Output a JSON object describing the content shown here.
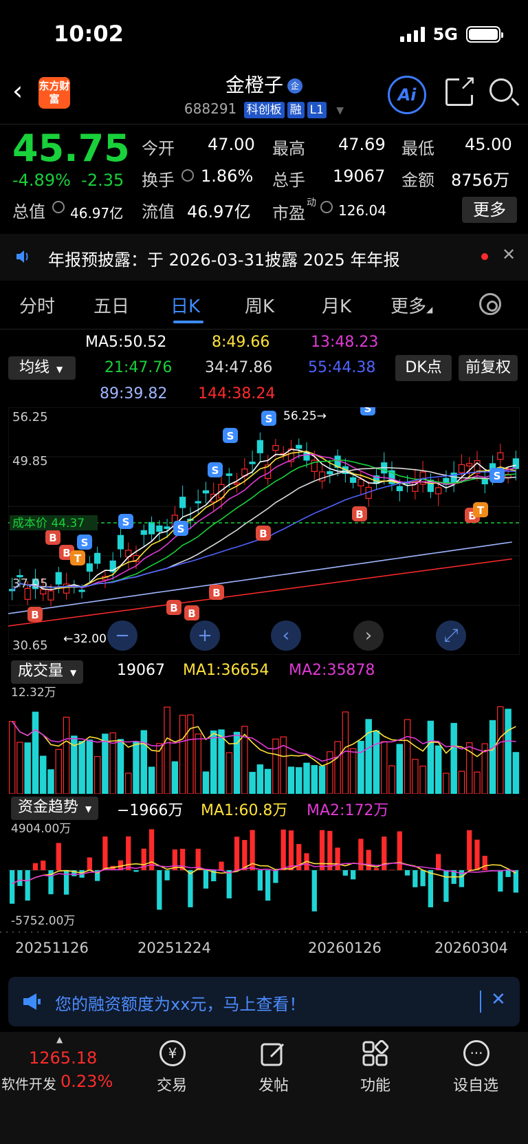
{
  "status": {
    "time": "10:02",
    "network": "5G"
  },
  "header": {
    "title": "金橙子",
    "title_badge": "企",
    "logo_text": "东方财富",
    "code": "688291",
    "tags": [
      "科创板",
      "融",
      "L1"
    ]
  },
  "quote": {
    "price": "45.75",
    "change_pct": "-4.89%",
    "change": "-2.35",
    "open_label": "今开",
    "open": "47.00",
    "high_label": "最高",
    "high": "47.69",
    "low_label": "最低",
    "low": "45.00",
    "turnover_label": "换手",
    "turnover": "1.86%",
    "volume_label": "总手",
    "volume": "19067",
    "amount_label": "金额",
    "amount": "8756万",
    "mcap_label": "总值",
    "mcap": "46.97亿",
    "float_label": "流值",
    "float_cap": "46.97亿",
    "pe_label": "市盈",
    "pe_sup": "动",
    "pe": "126.04",
    "more": "更多"
  },
  "notice": {
    "text": "年报预披露：于 2026-03-31披露 2025 年年报"
  },
  "tabs": [
    "分时",
    "五日",
    "日K",
    "周K",
    "月K",
    "更多"
  ],
  "ma": {
    "selector": "均线",
    "ma5": "MA5:50.52",
    "ma8": "8:49.66",
    "ma13": "13:48.23",
    "ma21": "21:47.76",
    "ma34": "34:47.86",
    "ma55": "55:44.38",
    "ma89": "89:39.82",
    "ma144": "144:38.24",
    "dk": "DK点",
    "adjust": "前复权"
  },
  "kchart": {
    "y_labels": [
      "56.25",
      "49.85",
      "37.05",
      "30.65"
    ],
    "high_marker": "56.25",
    "low_marker": "32.00",
    "cost_label": "成本价",
    "cost_value": "44.37",
    "trade_signals": {
      "buy": "B",
      "sell": "S",
      "t": "T"
    }
  },
  "volume": {
    "label": "成交量",
    "value": "19067",
    "ma1": "MA1:36654",
    "ma2": "MA2:35878",
    "scale": "12.32万"
  },
  "fund": {
    "label": "资金趋势",
    "value": "−1966万",
    "ma1": "MA1:60.8万",
    "ma2": "MA2:172万",
    "top": "4904.00万",
    "bottom": "-5752.00万"
  },
  "dates": [
    "20251126",
    "20251224",
    "20260126",
    "20260304"
  ],
  "promo": {
    "text": "您的融资额度为xx元，马上查看！"
  },
  "bottom_nav": {
    "index_value": "1265.18",
    "index_name": "软件开发",
    "index_change": "0.23%",
    "trade": "交易",
    "post": "发帖",
    "function": "功能",
    "watchlist": "设自选"
  },
  "colors": {
    "up": "#ff2b2b",
    "down": "#19d13a",
    "cyan": "#21d4d4",
    "accent": "#3d8cff"
  }
}
